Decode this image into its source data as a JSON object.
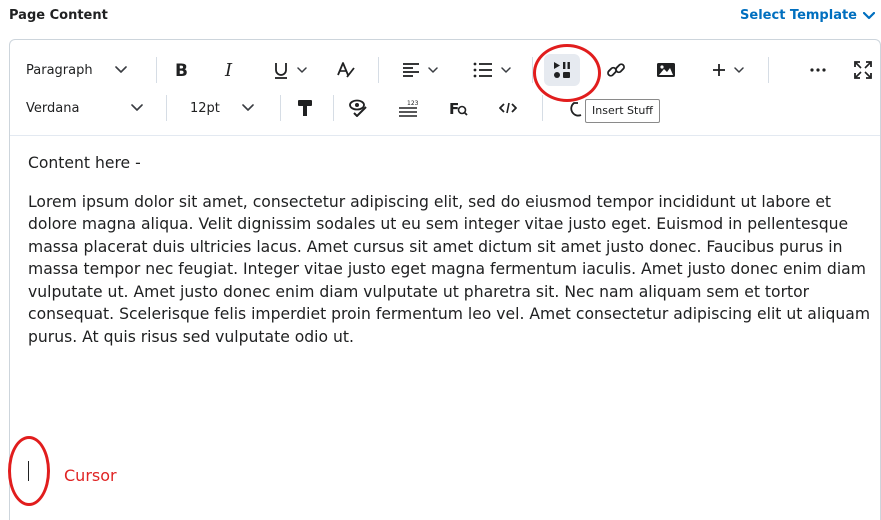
{
  "header": {
    "label": "Page Content",
    "select_template": "Select Template"
  },
  "toolbar": {
    "block_format": "Paragraph",
    "font_family": "Verdana",
    "font_size": "12pt",
    "insert_stuff_tooltip": "Insert Stuff"
  },
  "content": {
    "heading_text": "Content here -",
    "paragraph": "Lorem ipsum dolor sit amet, consectetur adipiscing elit, sed do eiusmod tempor incididunt ut labore et dolore magna aliqua. Velit dignissim sodales ut eu sem integer vitae justo eget. Euismod in pellentesque massa placerat duis ultricies lacus. Amet cursus sit amet dictum sit amet justo donec. Faucibus purus in massa tempor nec feugiat. Integer vitae justo eget magna fermentum iaculis. Amet justo donec enim diam vulputate ut. Amet justo donec enim diam vulputate ut pharetra sit. Nec nam aliquam sem et tortor consequat. Scelerisque felis imperdiet proin fermentum leo vel. Amet consectetur adipiscing elit ut aliquam purus. At quis risus sed vulputate odio ut."
  },
  "annotations": {
    "cursor_label": "Cursor",
    "color": "#e11d1d"
  },
  "colors": {
    "link_blue": "#006fbf",
    "text": "#202122",
    "border": "#cdd5dc"
  }
}
